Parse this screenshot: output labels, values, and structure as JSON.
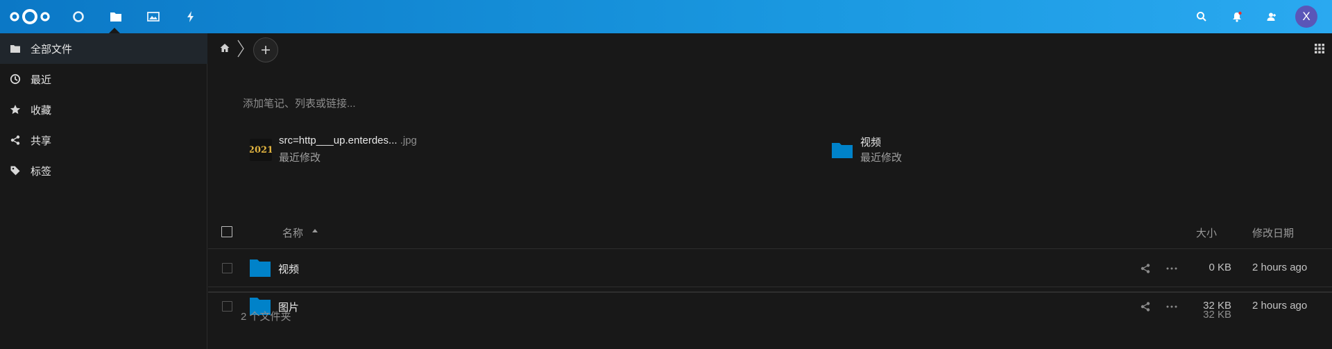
{
  "header": {
    "apps": [
      {
        "name": "dashboard",
        "icon": "circle-icon"
      },
      {
        "name": "files",
        "icon": "folder-icon"
      },
      {
        "name": "photos",
        "icon": "image-icon"
      },
      {
        "name": "activity",
        "icon": "lightning-icon"
      }
    ],
    "right_icons": [
      "search-icon",
      "notifications-icon",
      "contacts-icon"
    ],
    "avatar_initial": "X",
    "avatar_color": "#5a56b8",
    "accent": "#1a98e0"
  },
  "sidebar": {
    "items": [
      {
        "label": "全部文件",
        "icon": "folder-icon",
        "active": true
      },
      {
        "label": "最近",
        "icon": "clock-icon"
      },
      {
        "label": "收藏",
        "icon": "star-icon"
      },
      {
        "label": "共享",
        "icon": "share-icon"
      },
      {
        "label": "标签",
        "icon": "tag-icon"
      }
    ]
  },
  "main": {
    "note_placeholder": "添加笔记、列表或链接...",
    "recent": [
      {
        "name": "src=http___up.enterdes...",
        "ext": ".jpg",
        "sub": "最近修改",
        "thumb_text": "2021"
      },
      {
        "name": "视频",
        "ext": "",
        "sub": "最近修改"
      }
    ],
    "table": {
      "col_name": "名称",
      "col_size": "大小",
      "col_date": "修改日期",
      "rows": [
        {
          "name": "视频",
          "size": "0 KB",
          "date": "2 hours ago"
        },
        {
          "name": "图片",
          "size": "32 KB",
          "date": "2 hours ago"
        }
      ],
      "summary_count": "2 个文件夹",
      "summary_size": "32 KB"
    },
    "folder_color": "#0082c9"
  }
}
